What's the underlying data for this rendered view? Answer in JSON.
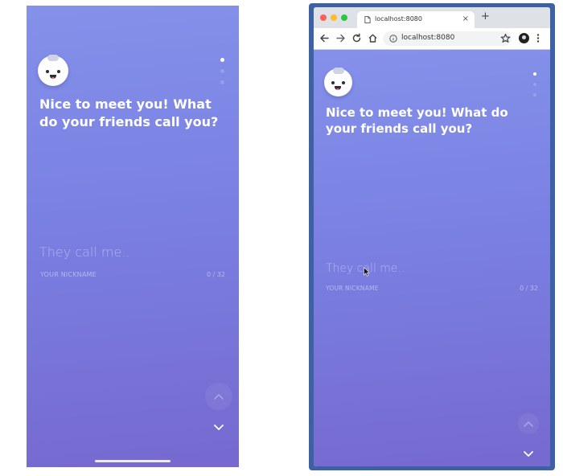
{
  "app": {
    "avatar_icon": "baby-face-avatar-icon",
    "question": "Nice to meet you! What do your friends call you?",
    "input_placeholder": "They call me..",
    "input_value": "",
    "helper_label": "YOUR NICKNAME",
    "char_counter": "0 / 32",
    "steps_total": 3,
    "active_step": 1,
    "nav_up_icon": "chevron-up-icon",
    "nav_down_icon": "chevron-down-icon",
    "colors": {
      "gradient_top": "#8491ea",
      "gradient_bottom": "#7669cf",
      "text": "#ffffff"
    }
  },
  "browser": {
    "tab_title": "localhost:8080",
    "url": "localhost:8080",
    "frame_color": "#3e61a3",
    "toolbar_icons": [
      "back-arrow-icon",
      "forward-arrow-icon",
      "reload-icon",
      "home-icon",
      "info-icon",
      "bookmark-star-icon",
      "profile-avatar-icon",
      "menu-dots-icon"
    ]
  }
}
